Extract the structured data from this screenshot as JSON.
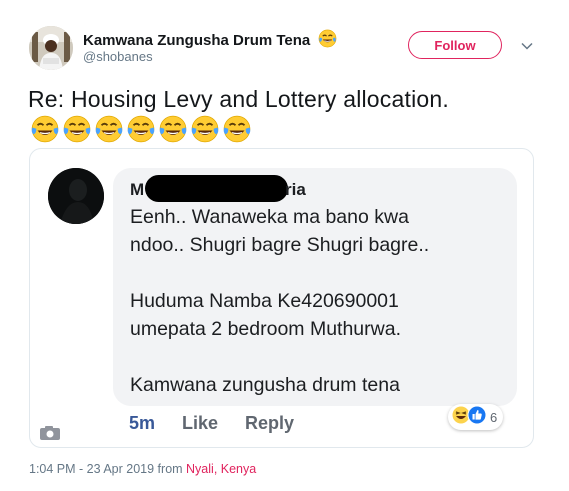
{
  "header": {
    "display_name": "Kamwana Zungusha Drum Tena",
    "handle": "@shobanes",
    "follow_label": "Follow",
    "name_emoji": "tears-of-joy-emoji"
  },
  "tweet": {
    "text": "Re: Housing Levy and Lottery allocation.",
    "emojis": [
      "tears-of-joy-emoji",
      "tears-of-joy-emoji",
      "tears-of-joy-emoji",
      "tears-of-joy-emoji",
      "tears-of-joy-emoji",
      "tears-of-joy-emoji",
      "tears-of-joy-emoji"
    ]
  },
  "embedded_comment": {
    "name_start": "M",
    "name_end": "ria",
    "body": [
      "Eenh.. Wanaweka ma bano kwa",
      "ndoo.. Shugri bagre Shugri bagre..",
      "Huduma Namba Ke420690001",
      "umepata 2 bedroom Muthurwa.",
      "Kamwana zungusha drum tena"
    ],
    "time": "5m",
    "like_label": "Like",
    "reply_label": "Reply",
    "reaction_count": "6",
    "reactions": [
      "haha-reaction",
      "like-reaction"
    ]
  },
  "footer": {
    "timestamp": "1:04 PM - 23 Apr 2019 from ",
    "location": "Nyali, Kenya"
  },
  "colors": {
    "accent": "#e0245e",
    "fb_link": "#385898",
    "bubble": "#f2f3f5"
  }
}
